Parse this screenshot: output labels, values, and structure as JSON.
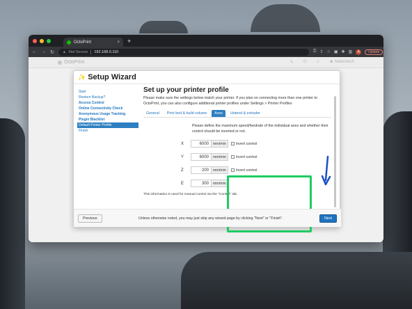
{
  "browser": {
    "tab_title": "OctoPrint",
    "tab_close": "×",
    "new_tab": "+",
    "not_secure": "Not Secure",
    "url": "192.168.0.110",
    "profile_initial": "A",
    "update_label": "Update"
  },
  "octoprint": {
    "brand": "OctoPrint",
    "user": "Makertech"
  },
  "wizard": {
    "title": "Setup Wizard",
    "steps": [
      {
        "label": "Start"
      },
      {
        "label": "Restore Backup?"
      },
      {
        "label": "Access Control"
      },
      {
        "label": "Online Connectivity Check"
      },
      {
        "label": "Anonymous Usage Tracking"
      },
      {
        "label": "Plugin Blacklist"
      },
      {
        "label": "Default Printer Profile"
      },
      {
        "label": "Finish"
      }
    ],
    "heading": "Set up your printer profile",
    "intro": "Please make sure the settings below match your printer. If you plan on connecting more than one printer to OctoPrint, you can also configure additional printer profiles under Settings > Printer Profiles",
    "tabs": [
      {
        "label": "General"
      },
      {
        "label": "Print bed & build volume"
      },
      {
        "label": "Axes"
      },
      {
        "label": "Hotend & extruder"
      }
    ],
    "axes_description": "Please define the maximum speed/feedrate of the individual axes and whether their control should be inverted or not.",
    "axes": [
      {
        "label": "X",
        "value": "6000",
        "unit": "mm/min",
        "invert": "Invert control"
      },
      {
        "label": "Y",
        "value": "6000",
        "unit": "mm/min",
        "invert": "Invert control"
      },
      {
        "label": "Z",
        "value": "200",
        "unit": "mm/min",
        "invert": "Invert control"
      },
      {
        "label": "E",
        "value": "300",
        "unit": "mm/min"
      }
    ],
    "note": "This information is used for manual control via the \"Control\" tab.",
    "footer_text": "Unless otherwise noted, you may just skip any wizard page by clicking \"Next\" or \"Finish\".",
    "previous": "Previous",
    "next": "Next"
  },
  "colors": {
    "highlight": "#1ecb62",
    "arrow": "#1a4fc4",
    "accent": "#2d7fc1"
  }
}
